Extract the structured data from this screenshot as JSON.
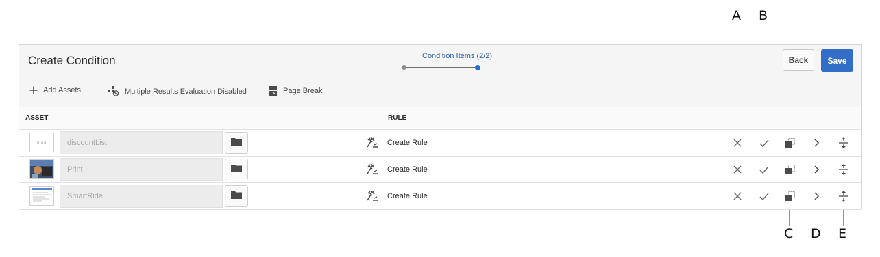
{
  "callouts": {
    "a": "A",
    "b": "B",
    "c": "C",
    "d": "D",
    "e": "E"
  },
  "header": {
    "title": "Create Condition",
    "wizard_label": "Condition Items (2/2)",
    "back_label": "Back",
    "save_label": "Save"
  },
  "toolbar": {
    "add_assets": "Add Assets",
    "multiple_results": "Multiple Results Evaluation Disabled",
    "page_break": "Page Break"
  },
  "columns": {
    "asset": "ASSET",
    "rule": "RULE"
  },
  "rows": [
    {
      "asset": "discountList",
      "rule_label": "Create Rule",
      "thumb": "text-doc-icon"
    },
    {
      "asset": "Print",
      "rule_label": "Create Rule",
      "thumb": "photo-thumbnail"
    },
    {
      "asset": "SmartRide",
      "rule_label": "Create Rule",
      "thumb": "document-thumbnail"
    }
  ],
  "colors": {
    "accent": "#326ec8",
    "callout_line": "#e8735a",
    "wizard_active": "#2d6ad4"
  },
  "icons": [
    "plus-icon",
    "multiple-results-icon",
    "page-break-icon",
    "folder-icon",
    "gavel-rule-icon",
    "delete-x-icon",
    "checkmark-icon",
    "copy-icon",
    "chevron-right-icon",
    "move-icon"
  ]
}
